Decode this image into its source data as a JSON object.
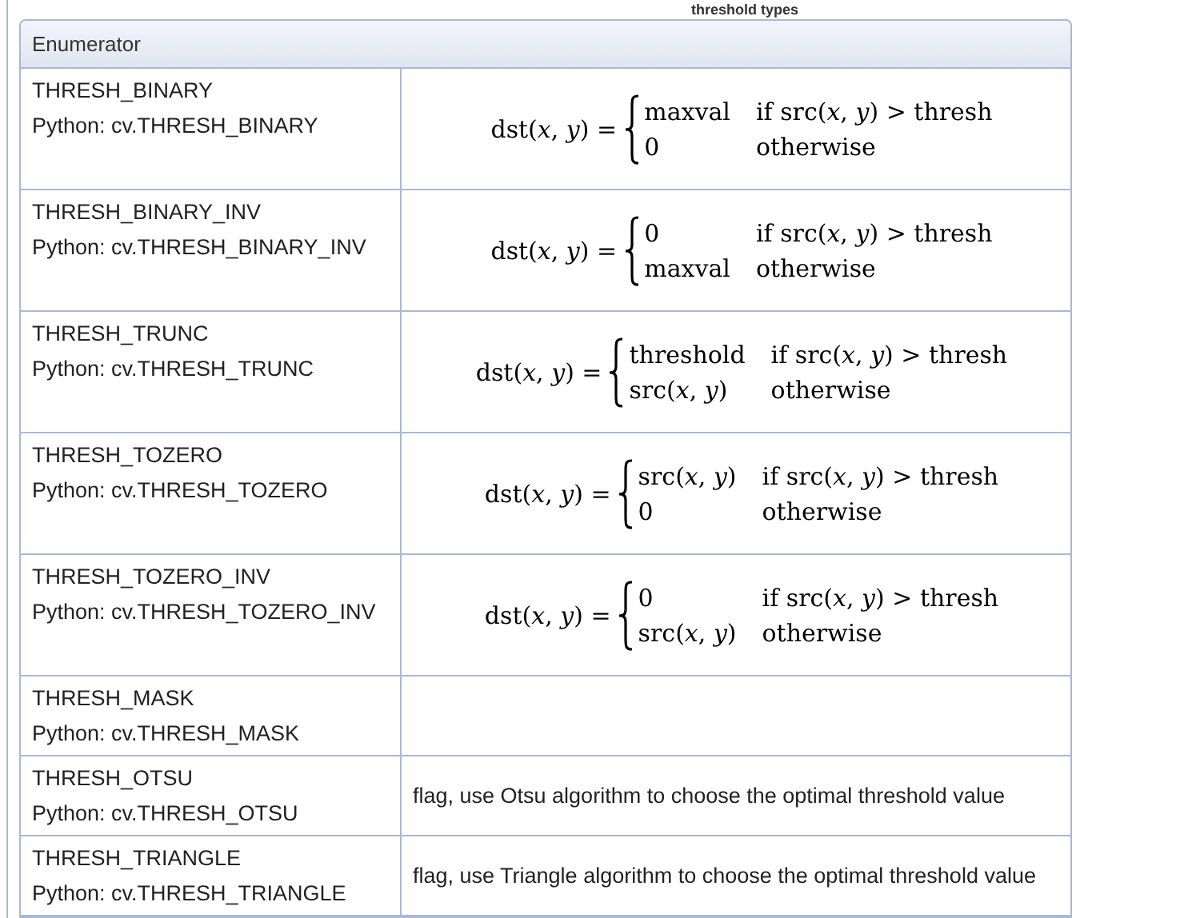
{
  "caption": "threshold types",
  "table": {
    "columns": [
      "Enumerator"
    ],
    "rows": [
      {
        "name": "THRESH_BINARY",
        "python": "Python: cv.THRESH_BINARY",
        "formula": {
          "lhs": "dst(*x*, *y*) =",
          "cases": [
            {
              "value": "maxval",
              "condition": "if src(*x*, *y*) > thresh"
            },
            {
              "value": "0",
              "condition": "otherwise"
            }
          ]
        }
      },
      {
        "name": "THRESH_BINARY_INV",
        "python": "Python: cv.THRESH_BINARY_INV",
        "formula": {
          "lhs": "dst(*x*, *y*) =",
          "cases": [
            {
              "value": "0",
              "condition": "if src(*x*, *y*) > thresh"
            },
            {
              "value": "maxval",
              "condition": "otherwise"
            }
          ]
        }
      },
      {
        "name": "THRESH_TRUNC",
        "python": "Python: cv.THRESH_TRUNC",
        "formula": {
          "lhs": "dst(*x*, *y*) =",
          "cases": [
            {
              "value": "threshold",
              "condition": "if src(*x*, *y*) > thresh"
            },
            {
              "value": "src(*x*, *y*)",
              "condition": "otherwise"
            }
          ]
        }
      },
      {
        "name": "THRESH_TOZERO",
        "python": "Python: cv.THRESH_TOZERO",
        "formula": {
          "lhs": "dst(*x*, *y*) =",
          "cases": [
            {
              "value": "src(*x*, *y*)",
              "condition": "if src(*x*, *y*) > thresh"
            },
            {
              "value": "0",
              "condition": "otherwise"
            }
          ]
        }
      },
      {
        "name": "THRESH_TOZERO_INV",
        "python": "Python: cv.THRESH_TOZERO_INV",
        "formula": {
          "lhs": "dst(*x*, *y*) =",
          "cases": [
            {
              "value": "0",
              "condition": "if src(*x*, *y*) > thresh"
            },
            {
              "value": "src(*x*, *y*)",
              "condition": "otherwise"
            }
          ]
        }
      },
      {
        "name": "THRESH_MASK",
        "python": "Python: cv.THRESH_MASK"
      },
      {
        "name": "THRESH_OTSU",
        "python": "Python: cv.THRESH_OTSU",
        "description": "flag, use Otsu algorithm to choose the optimal threshold value"
      },
      {
        "name": "THRESH_TRIANGLE",
        "python": "Python: cv.THRESH_TRIANGLE",
        "description": "flag, use Triangle algorithm to choose the optimal threshold value"
      }
    ]
  }
}
